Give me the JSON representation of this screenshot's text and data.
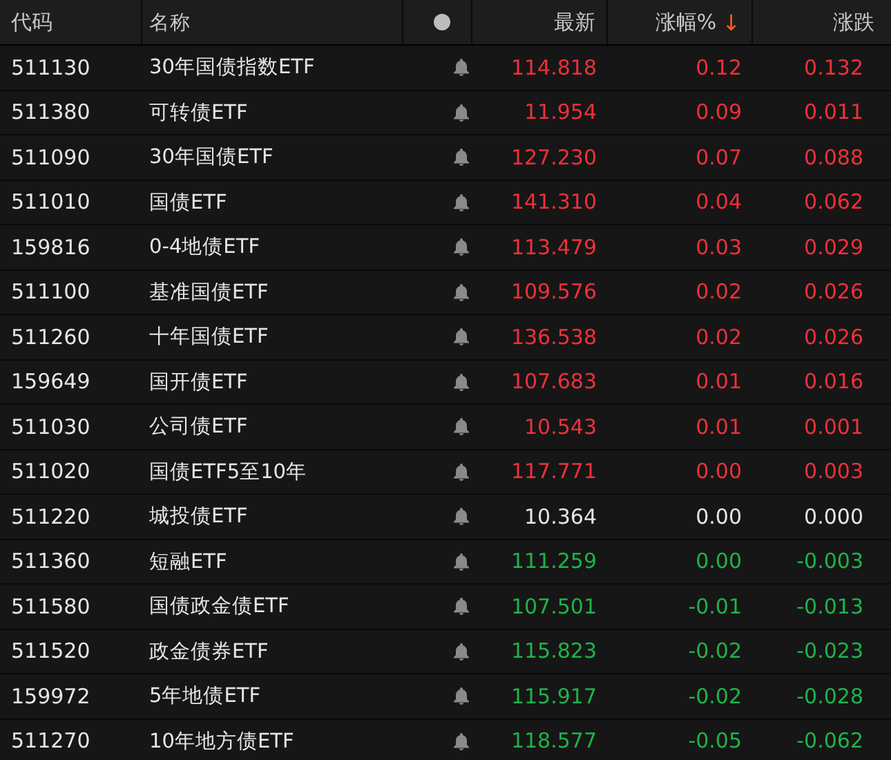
{
  "columns": [
    {
      "label": "代码"
    },
    {
      "label": "名称"
    },
    {
      "kind": "dot"
    },
    {
      "label": "最新"
    },
    {
      "label": "涨幅%",
      "sort_arrow": "↓"
    },
    {
      "label": "涨跌"
    }
  ],
  "rows": [
    {
      "code": "511130",
      "name": "30年国债指数ETF",
      "price": "114.818",
      "pct": "0.12",
      "change": "0.132",
      "color": "#f0303a"
    },
    {
      "code": "511380",
      "name": "可转债ETF",
      "price": "11.954",
      "pct": "0.09",
      "change": "0.011",
      "color": "#f0303a"
    },
    {
      "code": "511090",
      "name": "30年国债ETF",
      "price": "127.230",
      "pct": "0.07",
      "change": "0.088",
      "color": "#f0303a"
    },
    {
      "code": "511010",
      "name": "国债ETF",
      "price": "141.310",
      "pct": "0.04",
      "change": "0.062",
      "color": "#f0303a"
    },
    {
      "code": "159816",
      "name": "0-4地债ETF",
      "price": "113.479",
      "pct": "0.03",
      "change": "0.029",
      "color": "#f0303a"
    },
    {
      "code": "511100",
      "name": "基准国债ETF",
      "price": "109.576",
      "pct": "0.02",
      "change": "0.026",
      "color": "#f0303a"
    },
    {
      "code": "511260",
      "name": "十年国债ETF",
      "price": "136.538",
      "pct": "0.02",
      "change": "0.026",
      "color": "#f0303a"
    },
    {
      "code": "159649",
      "name": "国开债ETF",
      "price": "107.683",
      "pct": "0.01",
      "change": "0.016",
      "color": "#f0303a"
    },
    {
      "code": "511030",
      "name": "公司债ETF",
      "price": "10.543",
      "pct": "0.01",
      "change": "0.001",
      "color": "#f0303a"
    },
    {
      "code": "511020",
      "name": "国债ETF5至10年",
      "price": "117.771",
      "pct": "0.00",
      "change": "0.003",
      "color": "#f0303a"
    },
    {
      "code": "511220",
      "name": "城投债ETF",
      "price": "10.364",
      "pct": "0.00",
      "change": "0.000",
      "color": "#e6e6e6"
    },
    {
      "code": "511360",
      "name": "短融ETF",
      "price": "111.259",
      "pct": "0.00",
      "change": "-0.003",
      "color": "#1fb34a"
    },
    {
      "code": "511580",
      "name": "国债政金债ETF",
      "price": "107.501",
      "pct": "-0.01",
      "change": "-0.013",
      "color": "#1fb34a"
    },
    {
      "code": "511520",
      "name": "政金债券ETF",
      "price": "115.823",
      "pct": "-0.02",
      "change": "-0.023",
      "color": "#1fb34a"
    },
    {
      "code": "159972",
      "name": "5年地债ETF",
      "price": "115.917",
      "pct": "-0.02",
      "change": "-0.028",
      "color": "#1fb34a"
    },
    {
      "code": "511270",
      "name": "10年地方债ETF",
      "price": "118.577",
      "pct": "-0.05",
      "change": "-0.062",
      "color": "#1fb34a"
    }
  ]
}
